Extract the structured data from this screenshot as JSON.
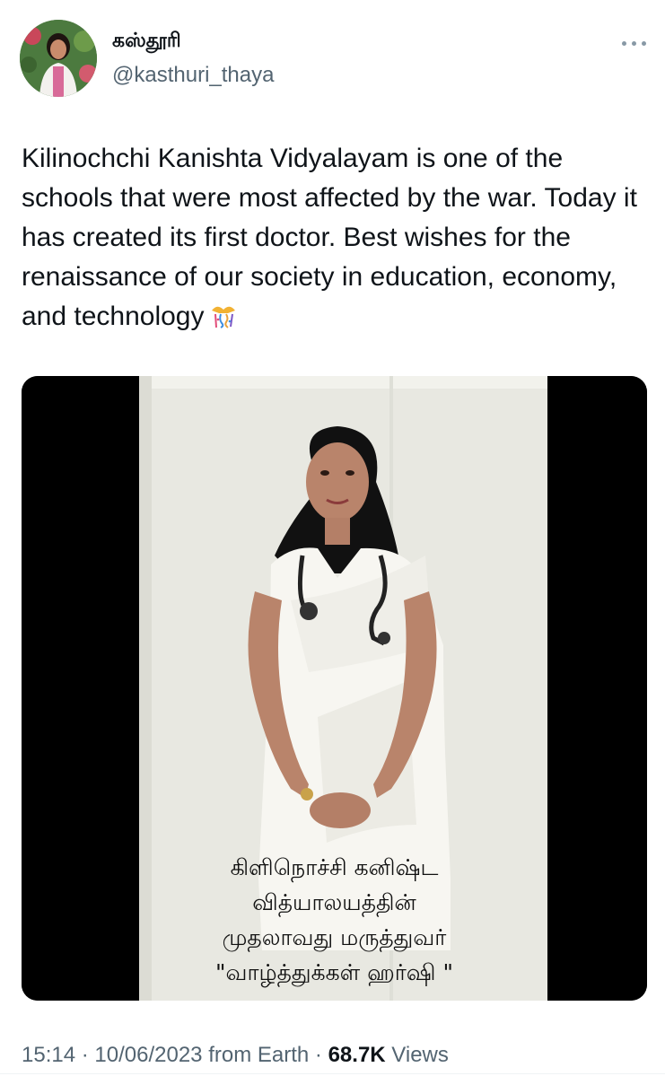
{
  "author": {
    "display_name": "கஸ்தூரி",
    "handle": "@kasthuri_thaya",
    "avatar_icon": "profile-photo"
  },
  "tweet": {
    "text": "Kilinochchi Kanishta Vidyalayam is one of the schools that were most affected by the war. Today it has created its first doctor. Best wishes for the renaissance of our society in education, economy, and technology",
    "emoji": "confetti-emoji"
  },
  "media": {
    "caption_lines": [
      "கிளிநொச்சி கனிஷ்ட",
      "வித்யாலயத்தின்",
      "முதலாவது மருத்துவர்",
      "\"வாழ்த்துக்கள் ஹர்ஷி \""
    ]
  },
  "meta": {
    "time": "15:14",
    "separator": "·",
    "date": "10/06/2023",
    "source": "from Earth",
    "views_count": "68.7K",
    "views_label": "Views"
  },
  "colors": {
    "text": "#0f1419",
    "secondary": "#536471"
  }
}
